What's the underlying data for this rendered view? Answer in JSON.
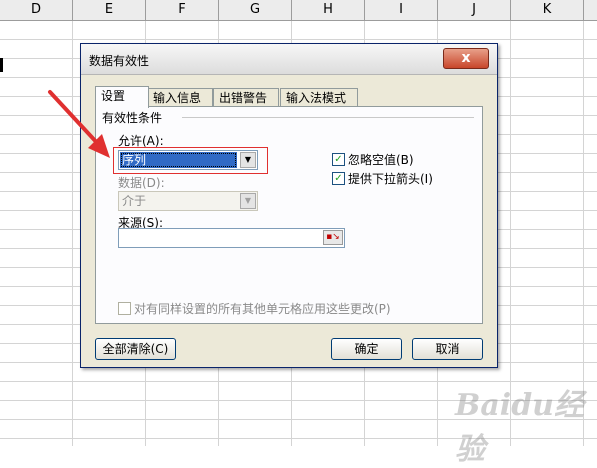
{
  "spreadsheet": {
    "columns": [
      "D",
      "E",
      "F",
      "G",
      "H",
      "I",
      "J",
      "K"
    ]
  },
  "dialog": {
    "title": "数据有效性",
    "close_label": "x",
    "tabs": [
      "设置",
      "输入信息",
      "出错警告",
      "输入法模式"
    ],
    "group_label": "有效性条件",
    "allow_label": "允许(A):",
    "allow_value": "序列",
    "data_label": "数据(D):",
    "data_value": "介于",
    "ignore_blank_label": "忽略空值(B)",
    "ignore_blank_checked": true,
    "dropdown_label": "提供下拉箭头(I)",
    "dropdown_checked": true,
    "source_label": "来源(S):",
    "source_value": "",
    "apply_all_label": "对有同样设置的所有其他单元格应用这些更改(P)",
    "apply_all_checked": false,
    "clear_all_label": "全部清除(C)",
    "ok_label": "确定",
    "cancel_label": "取消"
  },
  "watermark": "Baidu经验",
  "colors": {
    "highlight": "#e03030",
    "selection": "#316ac5",
    "check": "#21a121"
  }
}
